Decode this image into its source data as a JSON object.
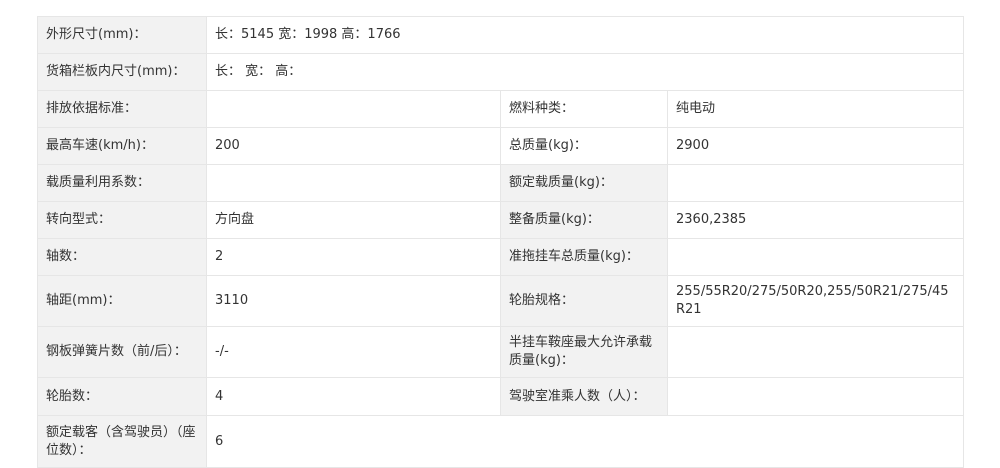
{
  "rows": [
    {
      "label": "外形尺寸(mm)：",
      "value": "长：5145 宽：1998 高：1766"
    },
    {
      "label": "货箱栏板内尺寸(mm)：",
      "value": "长： 宽： 高："
    },
    {
      "label": "排放依据标准：",
      "value": "",
      "label2": "燃料种类：",
      "value2": "纯电动"
    },
    {
      "label": "最高车速(km/h)：",
      "value": "200",
      "label2": "总质量(kg)：",
      "value2": "2900"
    },
    {
      "label": "载质量利用系数：",
      "value": "",
      "label2": "额定载质量(kg)：",
      "value2": ""
    },
    {
      "label": "转向型式：",
      "value": "方向盘",
      "label2": "整备质量(kg)：",
      "value2": "2360,2385"
    },
    {
      "label": "轴数：",
      "value": "2",
      "label2": "准拖挂车总质量(kg)：",
      "value2": ""
    },
    {
      "label": "轴距(mm)：",
      "value": "3110",
      "label2": "轮胎规格：",
      "value2": "255/55R20/275/50R20,255/50R21/275/45R21"
    },
    {
      "label": "钢板弹簧片数（前/后）：",
      "value": "-/-",
      "label2": "半挂车鞍座最大允许承载质量(kg)：",
      "value2": ""
    },
    {
      "label": "轮胎数：",
      "value": "4",
      "label2": "驾驶室准乘人数（人）：",
      "value2": ""
    },
    {
      "label": "额定载客（含驾驶员）（座位数）：",
      "value": "6"
    }
  ]
}
